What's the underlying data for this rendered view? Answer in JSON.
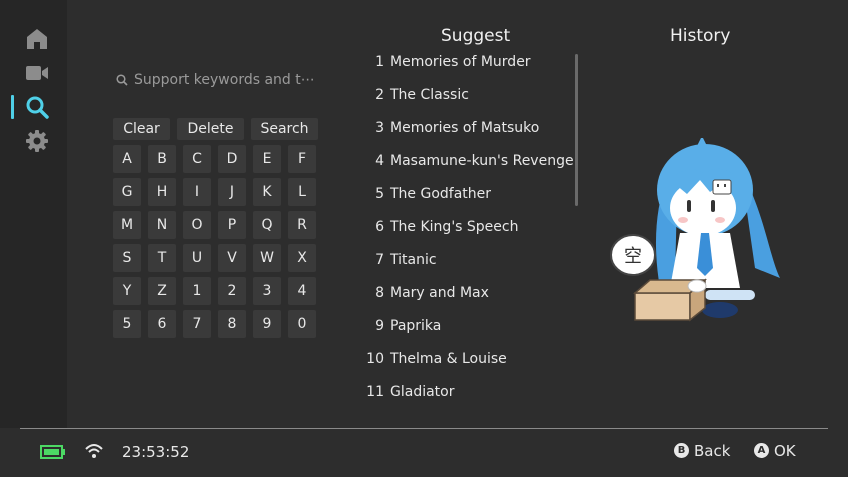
{
  "sidebar": {
    "items": [
      {
        "icon": "home-icon"
      },
      {
        "icon": "video-icon"
      },
      {
        "icon": "search-icon",
        "active": true
      },
      {
        "icon": "gear-icon"
      }
    ]
  },
  "search": {
    "placeholder": "Support keywords and t⋯"
  },
  "keyboard": {
    "functions": [
      "Clear",
      "Delete",
      "Search"
    ],
    "rows": [
      [
        "A",
        "B",
        "C",
        "D",
        "E",
        "F"
      ],
      [
        "G",
        "H",
        "I",
        "J",
        "K",
        "L"
      ],
      [
        "M",
        "N",
        "O",
        "P",
        "Q",
        "R"
      ],
      [
        "S",
        "T",
        "U",
        "V",
        "W",
        "X"
      ],
      [
        "Y",
        "Z",
        "1",
        "2",
        "3",
        "4"
      ],
      [
        "5",
        "6",
        "7",
        "8",
        "9",
        "0"
      ]
    ]
  },
  "suggest": {
    "title": "Suggest",
    "items": [
      {
        "num": "1",
        "title": "Memories of Murder"
      },
      {
        "num": "2",
        "title": "The Classic"
      },
      {
        "num": "3",
        "title": "Memories of Matsuko"
      },
      {
        "num": "4",
        "title": "Masamune-kun's Revenge"
      },
      {
        "num": "5",
        "title": "The Godfather"
      },
      {
        "num": "6",
        "title": "The King's Speech"
      },
      {
        "num": "7",
        "title": "Titanic"
      },
      {
        "num": "8",
        "title": "Mary and Max"
      },
      {
        "num": "9",
        "title": "Paprika"
      },
      {
        "num": "10",
        "title": "Thelma & Louise"
      },
      {
        "num": "11",
        "title": "Gladiator"
      }
    ]
  },
  "history": {
    "title": "History",
    "empty_text": "空"
  },
  "footer": {
    "battery": "battery-icon",
    "wifi": "wifi-icon",
    "time": "23:53:52",
    "back": {
      "button": "B",
      "label": "Back"
    },
    "ok": {
      "button": "A",
      "label": "OK"
    }
  },
  "colors": {
    "accent": "#4fd0e8",
    "battery": "#4cd964",
    "background": "#2d2d2d"
  }
}
